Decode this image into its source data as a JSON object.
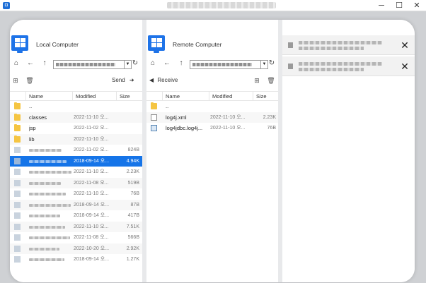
{
  "window": {
    "title": "",
    "app_icon": "app-logo-icon",
    "minimize": "─",
    "maximize": "☐",
    "close": "✕"
  },
  "local": {
    "title": "Local Computer",
    "path": "",
    "send_label": "Send",
    "columns": {
      "name": "Name",
      "modified": "Modified",
      "size": "Size"
    },
    "rows": [
      {
        "type": "parent",
        "name": "..",
        "modified": "",
        "size": ""
      },
      {
        "type": "folder",
        "name": "classes",
        "modified": "2022-11-10 오...",
        "size": ""
      },
      {
        "type": "folder",
        "name": "jsp",
        "modified": "2022-11-02 오...",
        "size": ""
      },
      {
        "type": "folder",
        "name": "lib",
        "modified": "2022-11-10 오...",
        "size": ""
      },
      {
        "type": "file",
        "name": "",
        "modified": "2022-11-02 오...",
        "size": "824B"
      },
      {
        "type": "file",
        "name": "",
        "modified": "2018-09-14 오...",
        "size": "4.94K",
        "selected": true
      },
      {
        "type": "file",
        "name": "",
        "modified": "2022-11-10 오...",
        "size": "2.23K"
      },
      {
        "type": "file",
        "name": "",
        "modified": "2022-11-08 오...",
        "size": "519B"
      },
      {
        "type": "file",
        "name": "",
        "modified": "2022-11-10 오...",
        "size": "76B"
      },
      {
        "type": "file",
        "name": "",
        "modified": "2018-09-14 오...",
        "size": "87B"
      },
      {
        "type": "file",
        "name": "",
        "modified": "2018-09-14 오...",
        "size": "417B"
      },
      {
        "type": "file",
        "name": "",
        "modified": "2022-11-10 오...",
        "size": "7.51K"
      },
      {
        "type": "file",
        "name": "",
        "modified": "2022-11-08 오...",
        "size": "566B"
      },
      {
        "type": "file",
        "name": "",
        "modified": "2022-10-20 오...",
        "size": "2.92K"
      },
      {
        "type": "file",
        "name": "",
        "modified": "2018-09-14 오...",
        "size": "1.27K"
      }
    ]
  },
  "remote": {
    "title": "Remote Computer",
    "path": "",
    "receive_label": "Receive",
    "columns": {
      "name": "Name",
      "modified": "Modified",
      "size": "Size"
    },
    "rows": [
      {
        "type": "parent",
        "name": "..",
        "modified": "",
        "size": ""
      },
      {
        "type": "doc",
        "name": "log4j.xml",
        "modified": "2022-11-10 오...",
        "size": "2.23K"
      },
      {
        "type": "doc-alt",
        "name": "log4jdbc.log4j...",
        "modified": "2022-11-10 오...",
        "size": "76B"
      }
    ]
  },
  "transfers": {
    "items": [
      {
        "text": ""
      },
      {
        "text": ""
      }
    ],
    "close_glyph": "✕"
  },
  "colors": {
    "accent": "#1574e8",
    "windows_blue": "#1e73e8",
    "folder": "#f5c542"
  }
}
